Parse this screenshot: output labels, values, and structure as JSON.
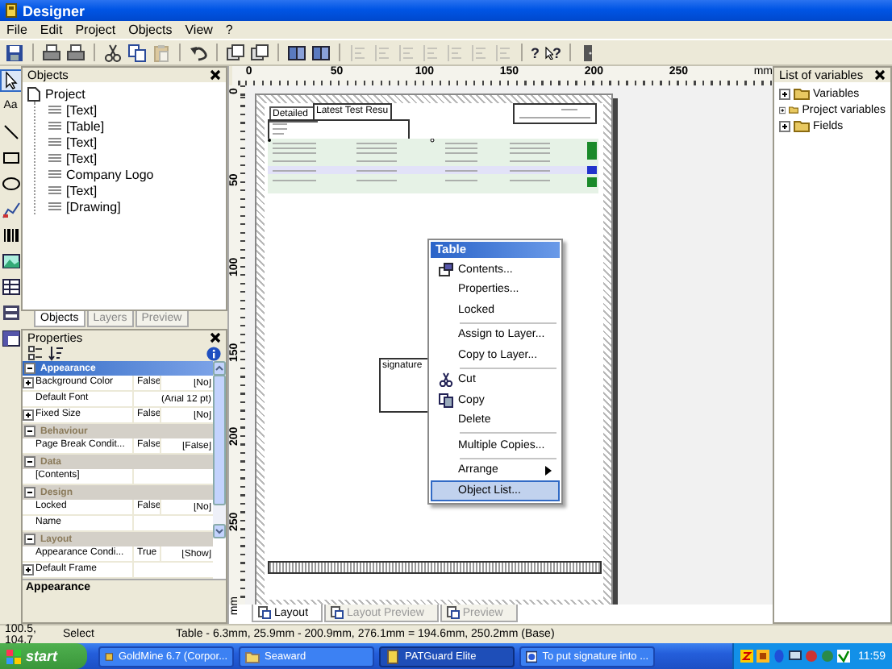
{
  "window": {
    "title": "Designer"
  },
  "menu": [
    {
      "label": "File"
    },
    {
      "label": "Edit"
    },
    {
      "label": "Project"
    },
    {
      "label": "Objects"
    },
    {
      "label": "View"
    },
    {
      "label": "?"
    }
  ],
  "toolbar": [
    {
      "kind": "save",
      "disabled": false
    },
    {
      "kind": "sep"
    },
    {
      "kind": "print",
      "disabled": false
    },
    {
      "kind": "print",
      "disabled": false
    },
    {
      "kind": "sep"
    },
    {
      "kind": "cut",
      "disabled": false
    },
    {
      "kind": "copy",
      "disabled": false
    },
    {
      "kind": "paste",
      "disabled": true
    },
    {
      "kind": "sep"
    },
    {
      "kind": "undo",
      "disabled": false
    },
    {
      "kind": "sep"
    },
    {
      "kind": "layers",
      "disabled": false
    },
    {
      "kind": "layers",
      "disabled": false
    },
    {
      "kind": "sep"
    },
    {
      "kind": "group",
      "disabled": false
    },
    {
      "kind": "group",
      "disabled": false
    },
    {
      "kind": "sep"
    },
    {
      "kind": "align",
      "disabled": true
    },
    {
      "kind": "align",
      "disabled": true
    },
    {
      "kind": "align",
      "disabled": true
    },
    {
      "kind": "align",
      "disabled": true
    },
    {
      "kind": "align",
      "disabled": true
    },
    {
      "kind": "align",
      "disabled": true
    },
    {
      "kind": "align",
      "disabled": true
    },
    {
      "kind": "sep"
    },
    {
      "kind": "help",
      "glyph": "?",
      "disabled": false
    },
    {
      "kind": "context_help",
      "glyph": "?",
      "disabled": false
    },
    {
      "kind": "sep"
    },
    {
      "kind": "door",
      "disabled": false
    }
  ],
  "tools": [
    {
      "kind": "select",
      "selected": true
    },
    {
      "kind": "text",
      "glyph": "Aa",
      "selected": false
    },
    {
      "kind": "line",
      "selected": false
    },
    {
      "kind": "rect",
      "selected": false
    },
    {
      "kind": "ellipse",
      "selected": false
    },
    {
      "kind": "chart",
      "selected": false
    },
    {
      "kind": "barcode",
      "selected": false
    },
    {
      "kind": "image",
      "selected": false
    },
    {
      "kind": "table",
      "selected": false
    },
    {
      "kind": "form",
      "selected": false
    },
    {
      "kind": "crosstab",
      "selected": false
    }
  ],
  "objects_panel": {
    "title": "Objects",
    "root": "Project",
    "items": [
      {
        "label": "[Text]"
      },
      {
        "label": "[Table]"
      },
      {
        "label": "[Text]"
      },
      {
        "label": "[Text]"
      },
      {
        "label": "Company Logo"
      },
      {
        "label": "[Text]"
      },
      {
        "label": "[Drawing]"
      }
    ],
    "tabs": [
      {
        "label": "Objects",
        "selected": true
      },
      {
        "label": "Layers",
        "selected": false
      },
      {
        "label": "Preview",
        "selected": false
      }
    ]
  },
  "properties_panel": {
    "title": "Properties",
    "groups": [
      {
        "name": "Appearance",
        "selected": true,
        "expanded": true,
        "rows": [
          {
            "name": "Background Color",
            "value": "False",
            "display": "[No]",
            "expandable": true
          },
          {
            "name": "Default Font",
            "display": "(Arial 12 pt)",
            "expandable": false
          },
          {
            "name": "Fixed Size",
            "value": "False",
            "display": "[No]",
            "expandable": true
          }
        ]
      },
      {
        "name": "Behaviour",
        "selected": false,
        "expanded": true,
        "rows": [
          {
            "name": "Page Break Condit...",
            "value": "False",
            "display": "[False]",
            "expandable": false
          }
        ]
      },
      {
        "name": "Data",
        "selected": false,
        "expanded": true,
        "rows": [
          {
            "name": "[Contents]",
            "expandable": false
          }
        ]
      },
      {
        "name": "Design",
        "selected": false,
        "expanded": true,
        "rows": [
          {
            "name": "Locked",
            "value": "False",
            "display": "[No]",
            "expandable": false
          },
          {
            "name": "Name",
            "expandable": false
          }
        ]
      },
      {
        "name": "Layout",
        "selected": false,
        "expanded": true,
        "rows": [
          {
            "name": "Appearance Condi...",
            "value": "True",
            "display": "[Show]",
            "expandable": false
          },
          {
            "name": "Default Frame",
            "expandable": true
          }
        ]
      }
    ],
    "description": "Appearance"
  },
  "canvas": {
    "ruler_h": [
      "0",
      "50",
      "100",
      "150",
      "200",
      "250",
      "mm"
    ],
    "ruler_v": [
      "0",
      "50",
      "100",
      "150",
      "200",
      "250",
      "mm"
    ],
    "report": {
      "header_label": "Detailed",
      "title_label": "Latest Test Resu",
      "signature_label": "signature"
    },
    "layout_tabs": [
      {
        "label": "Layout",
        "selected": true
      },
      {
        "label": "Layout Preview",
        "selected": false
      },
      {
        "label": "Preview",
        "selected": false
      }
    ]
  },
  "context_menu": {
    "title": "Table",
    "items": [
      {
        "kind": "item",
        "label": "Contents...",
        "selected": false
      },
      {
        "kind": "item",
        "label": "Properties...",
        "selected": false
      },
      {
        "kind": "item",
        "label": "Locked",
        "selected": false
      },
      {
        "kind": "separator"
      },
      {
        "kind": "item",
        "label": "Assign to Layer...",
        "selected": false
      },
      {
        "kind": "item",
        "label": "Copy to Layer...",
        "selected": false
      },
      {
        "kind": "separator"
      },
      {
        "kind": "item",
        "label": "Cut",
        "selected": false
      },
      {
        "kind": "item",
        "label": "Copy",
        "selected": false
      },
      {
        "kind": "item",
        "label": "Delete",
        "selected": false
      },
      {
        "kind": "separator"
      },
      {
        "kind": "item",
        "label": "Multiple Copies...",
        "selected": false
      },
      {
        "kind": "separator"
      },
      {
        "kind": "submenu",
        "label": "Arrange",
        "selected": false
      },
      {
        "kind": "item",
        "label": "Object List...",
        "selected": true
      }
    ]
  },
  "variables_panel": {
    "title": "List of variables",
    "items": [
      {
        "label": "Variables",
        "expanded": false
      },
      {
        "label": "Project variables",
        "expanded": false
      },
      {
        "label": "Fields",
        "expanded": false
      }
    ]
  },
  "status_bar": {
    "position": "100.5, 104.7",
    "mode": "Select",
    "info": "Table - 6.3mm, 25.9mm - 200.9mm, 276.1mm = 194.6mm, 250.2mm (Base)"
  },
  "taskbar": {
    "start": "start",
    "tasks": [
      {
        "label": "GoldMine 6.7 (Corpor...",
        "selected": false
      },
      {
        "label": "Seaward",
        "selected": false
      },
      {
        "label": "PATGuard Elite",
        "selected": true
      },
      {
        "label": "To put signature into ...",
        "selected": false
      }
    ],
    "clock": "11:59"
  }
}
